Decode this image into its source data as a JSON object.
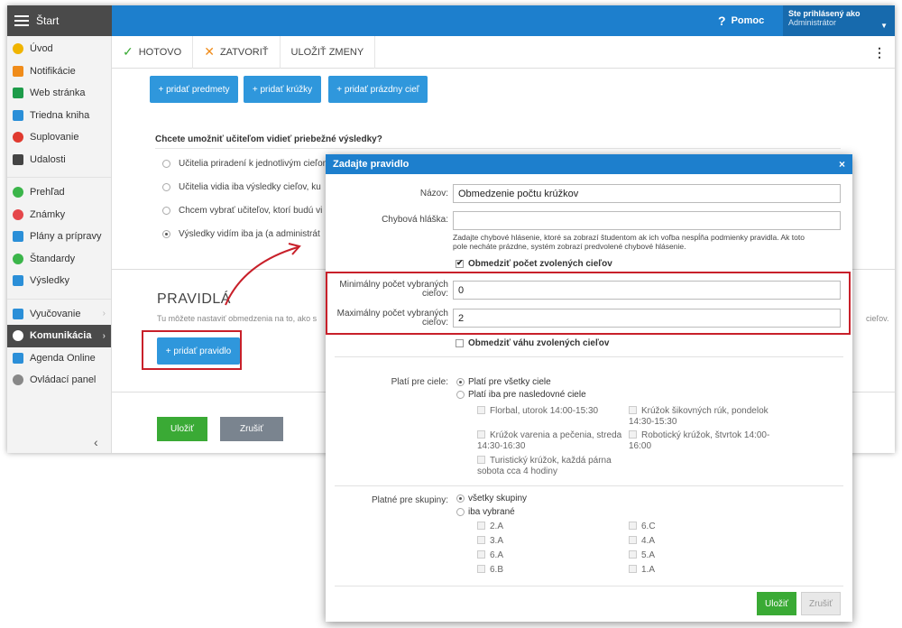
{
  "topbar": {
    "brand": "Štart",
    "help": "Pomoc",
    "user_line1": "Ste prihlásený ako",
    "user_line2": "Administrátor"
  },
  "sidebar": {
    "items": [
      {
        "label": "Úvod",
        "color": "#f0b400"
      },
      {
        "label": "Notifikácie",
        "color": "#f08c1a"
      },
      {
        "label": "Web stránka",
        "color": "#1e9c4a"
      },
      {
        "label": "Triedna kniha",
        "color": "#2b8fd8"
      },
      {
        "label": "Suplovanie",
        "color": "#e03a2f"
      },
      {
        "label": "Udalosti",
        "color": "#444444"
      },
      {
        "label": "Prehľad",
        "color": "#3bb54a"
      },
      {
        "label": "Známky",
        "color": "#e5474b"
      },
      {
        "label": "Plány a prípravy",
        "color": "#2b8fd8"
      },
      {
        "label": "Štandardy",
        "color": "#3bb54a"
      },
      {
        "label": "Výsledky",
        "color": "#2b8fd8"
      },
      {
        "label": "Vyučovanie",
        "color": "#2b8fd8"
      },
      {
        "label": "Komunikácia",
        "color": "#ffffff"
      },
      {
        "label": "Agenda Online",
        "color": "#2b8fd8"
      },
      {
        "label": "Ovládací panel",
        "color": "#888888"
      }
    ]
  },
  "toolbar": {
    "done": "HOTOVO",
    "close": "ZATVORIŤ",
    "save": "ULOŽIŤ ZMENY"
  },
  "content": {
    "add_subjects": "+ pridať predmety",
    "add_clubs": "+ pridať krúžky",
    "add_empty": "+ pridať prázdny cieľ",
    "question": "Chcete umožniť učiteľom vidieť priebežné výsledky?",
    "options": [
      "Učitelia priradení k jednotlivým cieľom",
      "Učitelia vidia iba výsledky cieľov, ku",
      "Chcem vybrať učiteľov, ktorí budú vi",
      "Výsledky vidím iba ja (a administrát"
    ],
    "rules_title": "PRAVIDLÁ",
    "rules_desc": "Tu môžete nastaviť obmedzenia na to, ako s",
    "rules_desc_tail": "cieľov.",
    "add_rule": "+ pridať pravidlo",
    "save": "Uložiť",
    "cancel": "Zrušiť"
  },
  "modal": {
    "title": "Zadajte pravidlo",
    "close": "×",
    "name_label": "Názov:",
    "name_value": "Obmedzenie počtu krúžkov",
    "error_label": "Chybová hláška:",
    "error_value": "",
    "error_hint": "Zadajte chybové hlásenie, ktoré sa zobrazí študentom ak ich voľba nespĺňa podmienky pravidla. Ak toto pole necháte prázdne, systém zobrazí predvolené chybové hlásenie.",
    "limit_count": "Obmedziť počet zvolených cieľov",
    "min_label": "Minimálny počet vybraných cieľov:",
    "min_value": "0",
    "max_label": "Maximálny počet vybraných cieľov:",
    "max_value": "2",
    "limit_weight": "Obmedziť váhu zvolených cieľov",
    "applies_label": "Platí pre ciele:",
    "applies_all": "Platí pre všetky ciele",
    "applies_some": "Platí iba pre nasledovné ciele",
    "goals": [
      "Florbal, utorok 14:00-15:30",
      "Krúžok šikovných rúk, pondelok 14:30-15:30",
      "Krúžok varenia a pečenia, streda 14:30-16:30",
      "Robotický krúžok, štvrtok 14:00-16:00",
      "Turistický krúžok, každá párna sobota cca 4 hodiny"
    ],
    "groups_label": "Platné pre skupiny:",
    "groups_all": "všetky skupiny",
    "groups_some": "iba vybrané",
    "groups": [
      "2.A",
      "6.C",
      "3.A",
      "4.A",
      "6.A",
      "5.A",
      "6.B",
      "1.A"
    ],
    "save": "Uložiť",
    "cancel": "Zrušiť"
  },
  "colors": {
    "blue": "#1d7fcd",
    "button_blue": "#2f97dc",
    "green": "#3aaa35",
    "annotation_red": "#c8202a"
  }
}
